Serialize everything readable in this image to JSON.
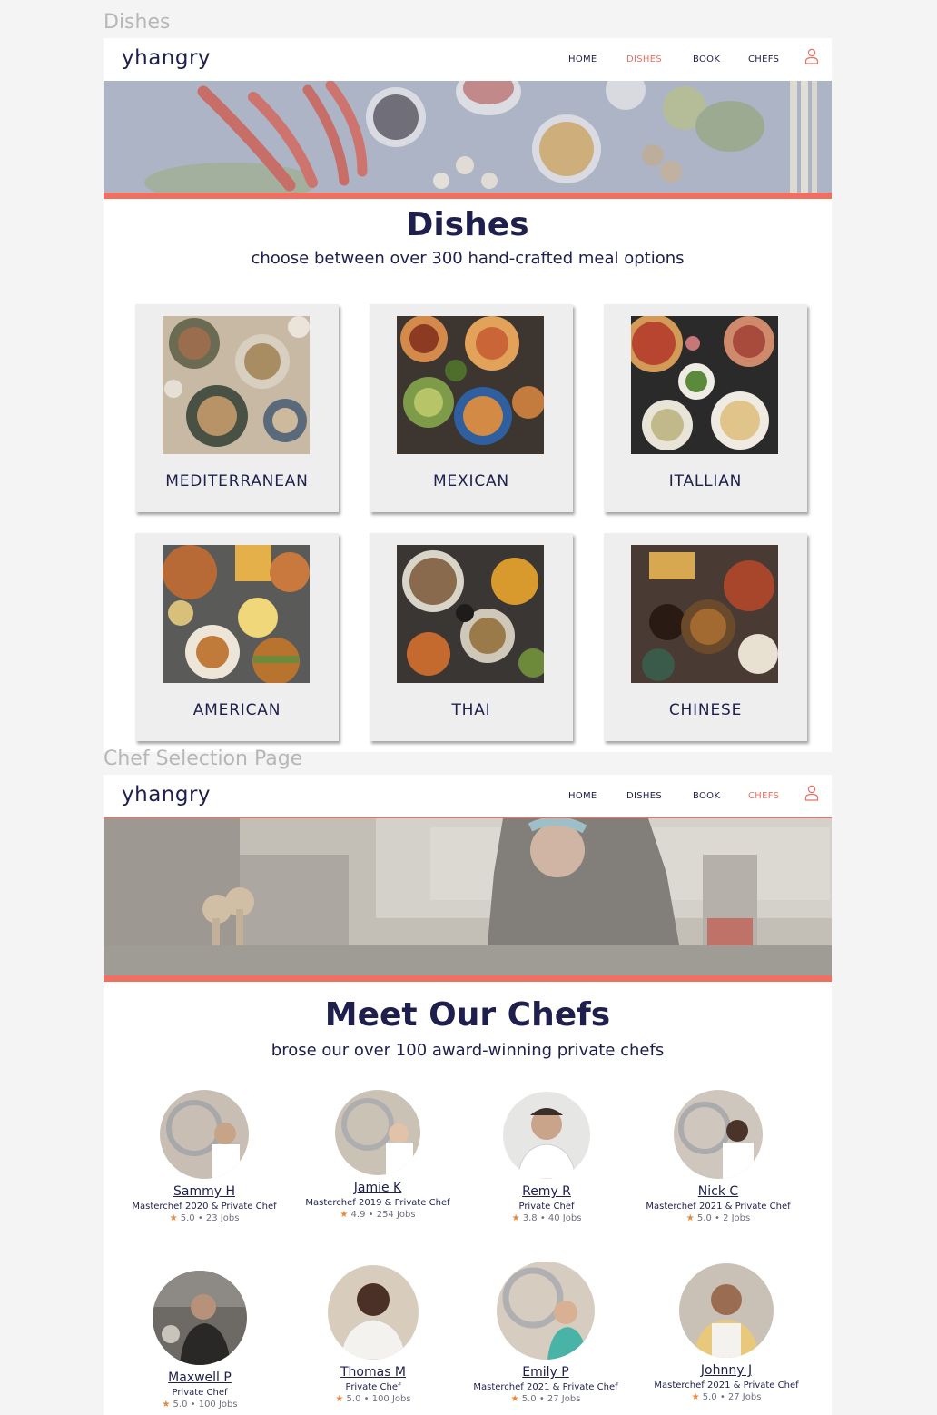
{
  "colors": {
    "accent": "#ef7060",
    "navy": "#1e1f4d",
    "card_bg": "#eeeeee",
    "star": "#e8863a"
  },
  "dishes_page": {
    "frame_label": "Dishes",
    "logo": "yhangry",
    "nav": [
      {
        "label": "HOME",
        "active": false
      },
      {
        "label": "DISHES",
        "active": true
      },
      {
        "label": "BOOK",
        "active": false
      },
      {
        "label": "CHEFS",
        "active": false
      }
    ],
    "user_icon": "user-icon",
    "title": "Dishes",
    "subtitle": "choose between over 300 hand-crafted meal options",
    "cuisines": [
      {
        "label": "MEDITERRANEAN"
      },
      {
        "label": "MEXICAN"
      },
      {
        "label": "ITALLIAN"
      },
      {
        "label": "AMERICAN"
      },
      {
        "label": "THAI"
      },
      {
        "label": "CHINESE"
      }
    ]
  },
  "chefs_page": {
    "frame_label": "Chef Selection Page",
    "logo": "yhangry",
    "nav": [
      {
        "label": "HOME",
        "active": false
      },
      {
        "label": "DISHES",
        "active": false
      },
      {
        "label": "BOOK",
        "active": false
      },
      {
        "label": "CHEFS",
        "active": true
      }
    ],
    "user_icon": "user-icon",
    "title": "Meet Our Chefs",
    "subtitle": "brose our over 100 award-winning private chefs",
    "chefs": [
      {
        "name": "Sammy H",
        "title": "Masterchef 2020 & Private Chef",
        "star": "★",
        "stats": "5.0 • 23 Jobs"
      },
      {
        "name": "Jamie K",
        "title": "Masterchef 2019 & Private Chef",
        "star": "★",
        "stats": "4.9 • 254 Jobs"
      },
      {
        "name": "Remy R",
        "title": "Private Chef",
        "star": "★",
        "stats": "3.8 • 40 Jobs"
      },
      {
        "name": "Nick C",
        "title": "Masterchef 2021 & Private Chef",
        "star": "★",
        "stats": "5.0 • 2 Jobs"
      },
      {
        "name": "Maxwell P",
        "title": "Private Chef",
        "star": "★",
        "stats": "5.0 • 100 Jobs"
      },
      {
        "name": "Thomas M",
        "title": "Private Chef",
        "star": "★",
        "stats": "5.0 • 100 Jobs"
      },
      {
        "name": "Emily P",
        "title": "Masterchef 2021 & Private Chef",
        "star": "★",
        "stats": "5.0 • 27 Jobs"
      },
      {
        "name": "Johnny J",
        "title": "Masterchef 2021 & Private Chef",
        "star": "★",
        "stats": "5.0 • 27 Jobs"
      }
    ]
  }
}
